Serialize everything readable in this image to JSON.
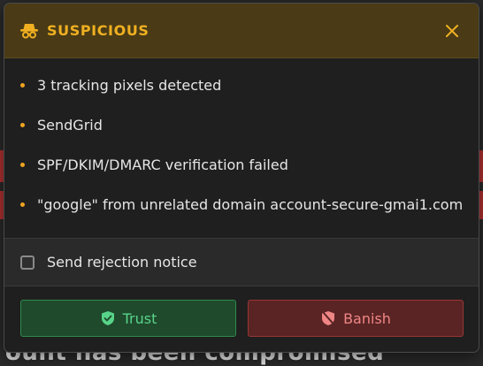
{
  "header": {
    "title": "SUSPICIOUS",
    "icon": "spy-icon",
    "close_icon": "close-icon",
    "accent_color": "#f0b021"
  },
  "reasons": [
    {
      "text": "3 tracking pixels detected"
    },
    {
      "text": "SendGrid"
    },
    {
      "text": "SPF/DKIM/DMARC verification failed"
    },
    {
      "text": "\"google\" from unrelated domain account-secure-gmai1.com"
    }
  ],
  "options": {
    "send_rejection_notice": {
      "label": "Send rejection notice",
      "checked": false
    }
  },
  "actions": {
    "trust": {
      "label": "Trust",
      "icon": "shield-check-icon",
      "color": "#58d48a"
    },
    "banish": {
      "label": "Banish",
      "icon": "shield-slash-icon",
      "color": "#f08585"
    }
  },
  "background": {
    "text": "ount has been compromised"
  }
}
